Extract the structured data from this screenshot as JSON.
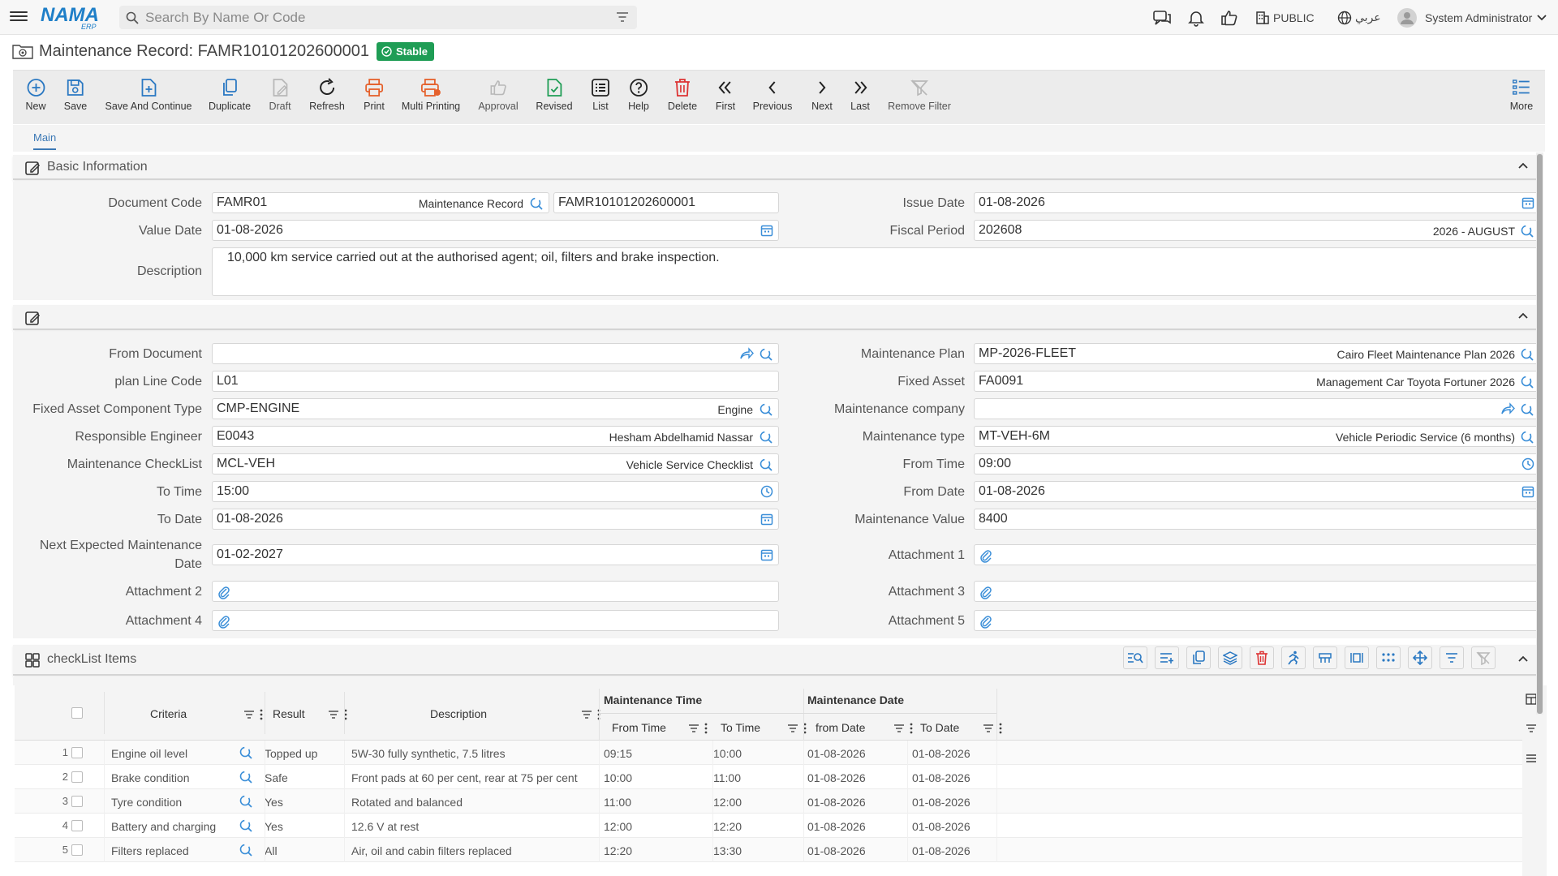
{
  "app": {
    "logo_text": "NAMA",
    "logo_sub": "ERP",
    "search_placeholder": "Search By Name Or Code",
    "public_label": "PUBLIC",
    "language_label": "عربي",
    "user_label": "System Administrator"
  },
  "page": {
    "title": "Maintenance Record: FAMR10101202600001",
    "status": "Stable"
  },
  "toolbar": {
    "new": "New",
    "save": "Save",
    "save_continue": "Save And Continue",
    "duplicate": "Duplicate",
    "draft": "Draft",
    "refresh": "Refresh",
    "print": "Print",
    "multi_printing": "Multi Printing",
    "approval": "Approval",
    "revised": "Revised",
    "list": "List",
    "help": "Help",
    "delete": "Delete",
    "first": "First",
    "previous": "Previous",
    "next": "Next",
    "last": "Last",
    "remove_filter": "Remove Filter",
    "more": "More"
  },
  "tabs": {
    "main": "Main"
  },
  "basic": {
    "section_title": "Basic Information",
    "doc_code_label": "Document Code",
    "doc_code": "FAMR01",
    "doc_code_desc": "Maintenance Record",
    "doc_number": "FAMR10101202600001",
    "issue_date_label": "Issue Date",
    "issue_date": "01-08-2026",
    "value_date_label": "Value Date",
    "value_date": "01-08-2026",
    "fiscal_period_label": "Fiscal Period",
    "fiscal_period": "202608",
    "fiscal_period_desc": "2026 - AUGUST",
    "description_label": "Description",
    "description": "10,000 km service carried out at the authorised agent; oil, filters and brake inspection."
  },
  "details": {
    "from_document_label": "From Document",
    "from_document": "",
    "maintenance_plan_label": "Maintenance Plan",
    "maintenance_plan": "MP-2026-FLEET",
    "maintenance_plan_desc": "Cairo Fleet Maintenance Plan 2026",
    "plan_line_label": "plan Line Code",
    "plan_line": "L01",
    "fixed_asset_label": "Fixed Asset",
    "fixed_asset": "FA0091",
    "fixed_asset_desc": "Management Car Toyota Fortuner 2026",
    "component_type_label": "Fixed Asset Component Type",
    "component_type": "CMP-ENGINE",
    "component_type_desc": "Engine",
    "maint_company_label": "Maintenance company",
    "maint_company": "",
    "engineer_label": "Responsible Engineer",
    "engineer": "E0043",
    "engineer_desc": "Hesham Abdelhamid Nassar",
    "maint_type_label": "Maintenance type",
    "maint_type": "MT-VEH-6M",
    "maint_type_desc": "Vehicle Periodic Service (6 months)",
    "checklist_label": "Maintenance CheckList",
    "checklist": "MCL-VEH",
    "checklist_desc": "Vehicle Service Checklist",
    "from_time_label": "From Time",
    "from_time": "09:00",
    "to_time_label": "To Time",
    "to_time": "15:00",
    "from_date_label": "From Date",
    "from_date": "01-08-2026",
    "to_date_label": "To Date",
    "to_date": "01-08-2026",
    "maint_value_label": "Maintenance Value",
    "maint_value": "8400",
    "next_date_label_1": "Next Expected Maintenance",
    "next_date_label_2": "Date",
    "next_date": "01-02-2027",
    "att1_label": "Attachment 1",
    "att2_label": "Attachment 2",
    "att3_label": "Attachment 3",
    "att4_label": "Attachment 4",
    "att5_label": "Attachment 5"
  },
  "checklist": {
    "section_title": "checkList Items",
    "group_time": "Maintenance Time",
    "group_date": "Maintenance Date",
    "columns": {
      "criteria": "Criteria",
      "result": "Result",
      "description": "Description",
      "from_time": "From Time",
      "to_time": "To Time",
      "from_date": "from Date",
      "to_date": "To Date"
    },
    "rows": [
      {
        "n": "1",
        "criteria": "Engine oil level",
        "result": "Topped up",
        "description": "5W-30 fully synthetic, 7.5 litres",
        "from_time": "09:15",
        "to_time": "10:00",
        "from_date": "01-08-2026",
        "to_date": "01-08-2026"
      },
      {
        "n": "2",
        "criteria": "Brake condition",
        "result": "Safe",
        "description": "Front pads at 60 per cent, rear at 75 per cent",
        "from_time": "10:00",
        "to_time": "11:00",
        "from_date": "01-08-2026",
        "to_date": "01-08-2026"
      },
      {
        "n": "3",
        "criteria": "Tyre condition",
        "result": "Yes",
        "description": "Rotated and balanced",
        "from_time": "11:00",
        "to_time": "12:00",
        "from_date": "01-08-2026",
        "to_date": "01-08-2026"
      },
      {
        "n": "4",
        "criteria": "Battery and charging",
        "result": "Yes",
        "description": "12.6 V at rest",
        "from_time": "12:00",
        "to_time": "12:20",
        "from_date": "01-08-2026",
        "to_date": "01-08-2026"
      },
      {
        "n": "5",
        "criteria": "Filters replaced",
        "result": "All",
        "description": "Air, oil and cabin filters replaced",
        "from_time": "12:20",
        "to_time": "13:30",
        "from_date": "01-08-2026",
        "to_date": "01-08-2026"
      }
    ]
  }
}
